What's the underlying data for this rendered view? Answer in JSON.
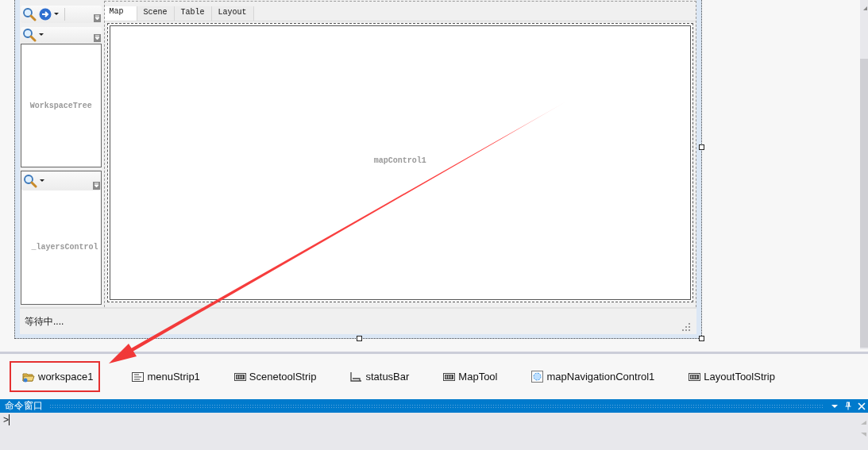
{
  "form": {
    "left_panel": {
      "top_toolbar": {
        "kind": "toolbar"
      },
      "workspace_tree": {
        "label": "WorkspaceTree"
      },
      "layers_control": {
        "label": "_layersControl"
      }
    },
    "tabs": [
      {
        "label": "Map",
        "selected": true
      },
      {
        "label": "Scene",
        "selected": false
      },
      {
        "label": "Table",
        "selected": false
      },
      {
        "label": "Layout",
        "selected": false
      }
    ],
    "map_control": {
      "label": "mapControl1"
    },
    "status_bar": {
      "text": "等待中...."
    }
  },
  "component_tray": [
    {
      "name": "workspace1",
      "kind": "folder",
      "highlighted": true
    },
    {
      "name": "menuStrip1",
      "kind": "menu",
      "highlighted": false
    },
    {
      "name": "ScenetoolStrip",
      "kind": "toolstrip",
      "highlighted": false
    },
    {
      "name": "statusBar",
      "kind": "statusbar",
      "highlighted": false
    },
    {
      "name": "MapTool",
      "kind": "toolstrip",
      "highlighted": false
    },
    {
      "name": "mapNavigationControl1",
      "kind": "navigation",
      "highlighted": false
    },
    {
      "name": "LayoutToolStrip",
      "kind": "toolstrip",
      "highlighted": false
    }
  ],
  "command_window": {
    "title": "命令窗口",
    "prompt": ">"
  }
}
